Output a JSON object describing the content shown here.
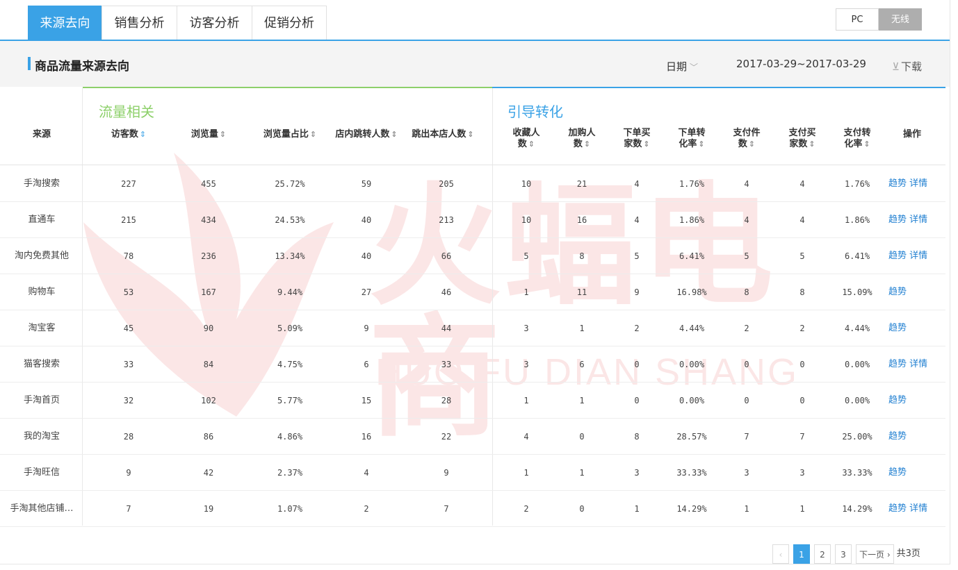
{
  "tabs": [
    "来源去向",
    "销售分析",
    "访客分析",
    "促销分析"
  ],
  "device_toggle": {
    "pc": "PC",
    "wireless": "无线",
    "active": "无线"
  },
  "section": {
    "title": "商品流量来源去向",
    "date_label": "日期",
    "date_range": "2017-03-29~2017-03-29",
    "download_label": "下载"
  },
  "groups": {
    "traffic": "流量相关",
    "conversion": "引导转化"
  },
  "columns": {
    "source": "来源",
    "visitors": "访客数",
    "pageviews": "浏览量",
    "pv_share": "浏览量占比",
    "jump_in_store": "店内跳转人数",
    "jump_out_store": "跳出本店人数",
    "favorites_l1": "收藏人",
    "favorites_l2": "数",
    "addcart_l1": "加购人",
    "addcart_l2": "数",
    "order_buyers_l1": "下单买",
    "order_buyers_l2": "家数",
    "order_rate_l1": "下单转",
    "order_rate_l2": "化率",
    "pay_items_l1": "支付件",
    "pay_items_l2": "数",
    "pay_buyers_l1": "支付买",
    "pay_buyers_l2": "家数",
    "pay_rate_l1": "支付转",
    "pay_rate_l2": "化率",
    "actions": "操作"
  },
  "sort_icon": "⇕",
  "rows": [
    {
      "source": "手淘搜索",
      "visitors": "227",
      "pageviews": "455",
      "pv_share": "25.72%",
      "jump_in": "59",
      "jump_out": "205",
      "fav": "10",
      "cart": "21",
      "order_buyers": "4",
      "order_rate": "1.76%",
      "pay_items": "4",
      "pay_buyers": "4",
      "pay_rate": "1.76%",
      "trend": "趋势",
      "detail": "详情"
    },
    {
      "source": "直通车",
      "visitors": "215",
      "pageviews": "434",
      "pv_share": "24.53%",
      "jump_in": "40",
      "jump_out": "213",
      "fav": "10",
      "cart": "16",
      "order_buyers": "4",
      "order_rate": "1.86%",
      "pay_items": "4",
      "pay_buyers": "4",
      "pay_rate": "1.86%",
      "trend": "趋势",
      "detail": "详情"
    },
    {
      "source": "淘内免费其他",
      "visitors": "78",
      "pageviews": "236",
      "pv_share": "13.34%",
      "jump_in": "40",
      "jump_out": "66",
      "fav": "5",
      "cart": "8",
      "order_buyers": "5",
      "order_rate": "6.41%",
      "pay_items": "5",
      "pay_buyers": "5",
      "pay_rate": "6.41%",
      "trend": "趋势",
      "detail": "详情"
    },
    {
      "source": "购物车",
      "visitors": "53",
      "pageviews": "167",
      "pv_share": "9.44%",
      "jump_in": "27",
      "jump_out": "46",
      "fav": "1",
      "cart": "11",
      "order_buyers": "9",
      "order_rate": "16.98%",
      "pay_items": "8",
      "pay_buyers": "8",
      "pay_rate": "15.09%",
      "trend": "趋势",
      "detail": ""
    },
    {
      "source": "淘宝客",
      "visitors": "45",
      "pageviews": "90",
      "pv_share": "5.09%",
      "jump_in": "9",
      "jump_out": "44",
      "fav": "3",
      "cart": "1",
      "order_buyers": "2",
      "order_rate": "4.44%",
      "pay_items": "2",
      "pay_buyers": "2",
      "pay_rate": "4.44%",
      "trend": "趋势",
      "detail": ""
    },
    {
      "source": "猫客搜索",
      "visitors": "33",
      "pageviews": "84",
      "pv_share": "4.75%",
      "jump_in": "6",
      "jump_out": "33",
      "fav": "3",
      "cart": "6",
      "order_buyers": "0",
      "order_rate": "0.00%",
      "pay_items": "0",
      "pay_buyers": "0",
      "pay_rate": "0.00%",
      "trend": "趋势",
      "detail": "详情"
    },
    {
      "source": "手淘首页",
      "visitors": "32",
      "pageviews": "102",
      "pv_share": "5.77%",
      "jump_in": "15",
      "jump_out": "28",
      "fav": "1",
      "cart": "1",
      "order_buyers": "0",
      "order_rate": "0.00%",
      "pay_items": "0",
      "pay_buyers": "0",
      "pay_rate": "0.00%",
      "trend": "趋势",
      "detail": ""
    },
    {
      "source": "我的淘宝",
      "visitors": "28",
      "pageviews": "86",
      "pv_share": "4.86%",
      "jump_in": "16",
      "jump_out": "22",
      "fav": "4",
      "cart": "0",
      "order_buyers": "8",
      "order_rate": "28.57%",
      "pay_items": "7",
      "pay_buyers": "7",
      "pay_rate": "25.00%",
      "trend": "趋势",
      "detail": ""
    },
    {
      "source": "手淘旺信",
      "visitors": "9",
      "pageviews": "42",
      "pv_share": "2.37%",
      "jump_in": "4",
      "jump_out": "9",
      "fav": "1",
      "cart": "1",
      "order_buyers": "3",
      "order_rate": "33.33%",
      "pay_items": "3",
      "pay_buyers": "3",
      "pay_rate": "33.33%",
      "trend": "趋势",
      "detail": ""
    },
    {
      "source": "手淘其他店铺…",
      "visitors": "7",
      "pageviews": "19",
      "pv_share": "1.07%",
      "jump_in": "2",
      "jump_out": "7",
      "fav": "2",
      "cart": "0",
      "order_buyers": "1",
      "order_rate": "14.29%",
      "pay_items": "1",
      "pay_buyers": "1",
      "pay_rate": "14.29%",
      "trend": "趋势",
      "detail": "详情"
    }
  ],
  "pagination": {
    "prev": "‹",
    "pages": [
      "1",
      "2",
      "3"
    ],
    "current": "1",
    "next": "下一页 ›",
    "total": "共3页"
  },
  "watermark": {
    "cn": "火蝠电商",
    "en": "HUO FU DIAN SHANG"
  }
}
